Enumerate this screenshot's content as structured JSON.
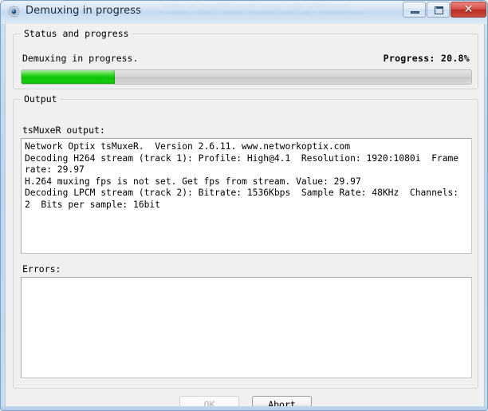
{
  "window": {
    "title": "Demuxing in progress",
    "icon": "gear-disc-icon",
    "glass_ghost_text": "  ─ ─────  ──  ─────────  ──────  ──────  ─────  ────── ─────\n ─  ────── ─ ──── ── ────── ─ ─────── ────── ──/──  ──────── ────",
    "controls": {
      "minimize": "minimize-icon",
      "maximize": "maximize-icon",
      "close": "✕"
    }
  },
  "status_group": {
    "title": "Status and progress",
    "status_text": "Demuxing in progress.",
    "progress_label": "Progress: 20.8%",
    "progress_percent": 20.8,
    "progress_fill_color": "#0cc207",
    "progress_track_color": "#d2d2d2"
  },
  "output_group": {
    "title": "Output",
    "output_label": "tsMuxeR output:",
    "output_lines": [
      "Network Optix tsMuxeR.  Version 2.6.11. www.networkoptix.com",
      "Decoding H264 stream (track 1): Profile: High@4.1  Resolution: 1920:1080i  Frame rate: 29.97",
      "H.264 muxing fps is not set. Get fps from stream. Value: 29.97",
      "Decoding LPCM stream (track 2): Bitrate: 1536Kbps  Sample Rate: 48KHz  Channels: 2  Bits per sample: 16bit"
    ],
    "errors_label": "Errors:",
    "errors_text": ""
  },
  "buttons": {
    "ok_label": "OK",
    "ok_enabled": false,
    "abort_label": "Abort",
    "abort_enabled": true
  }
}
